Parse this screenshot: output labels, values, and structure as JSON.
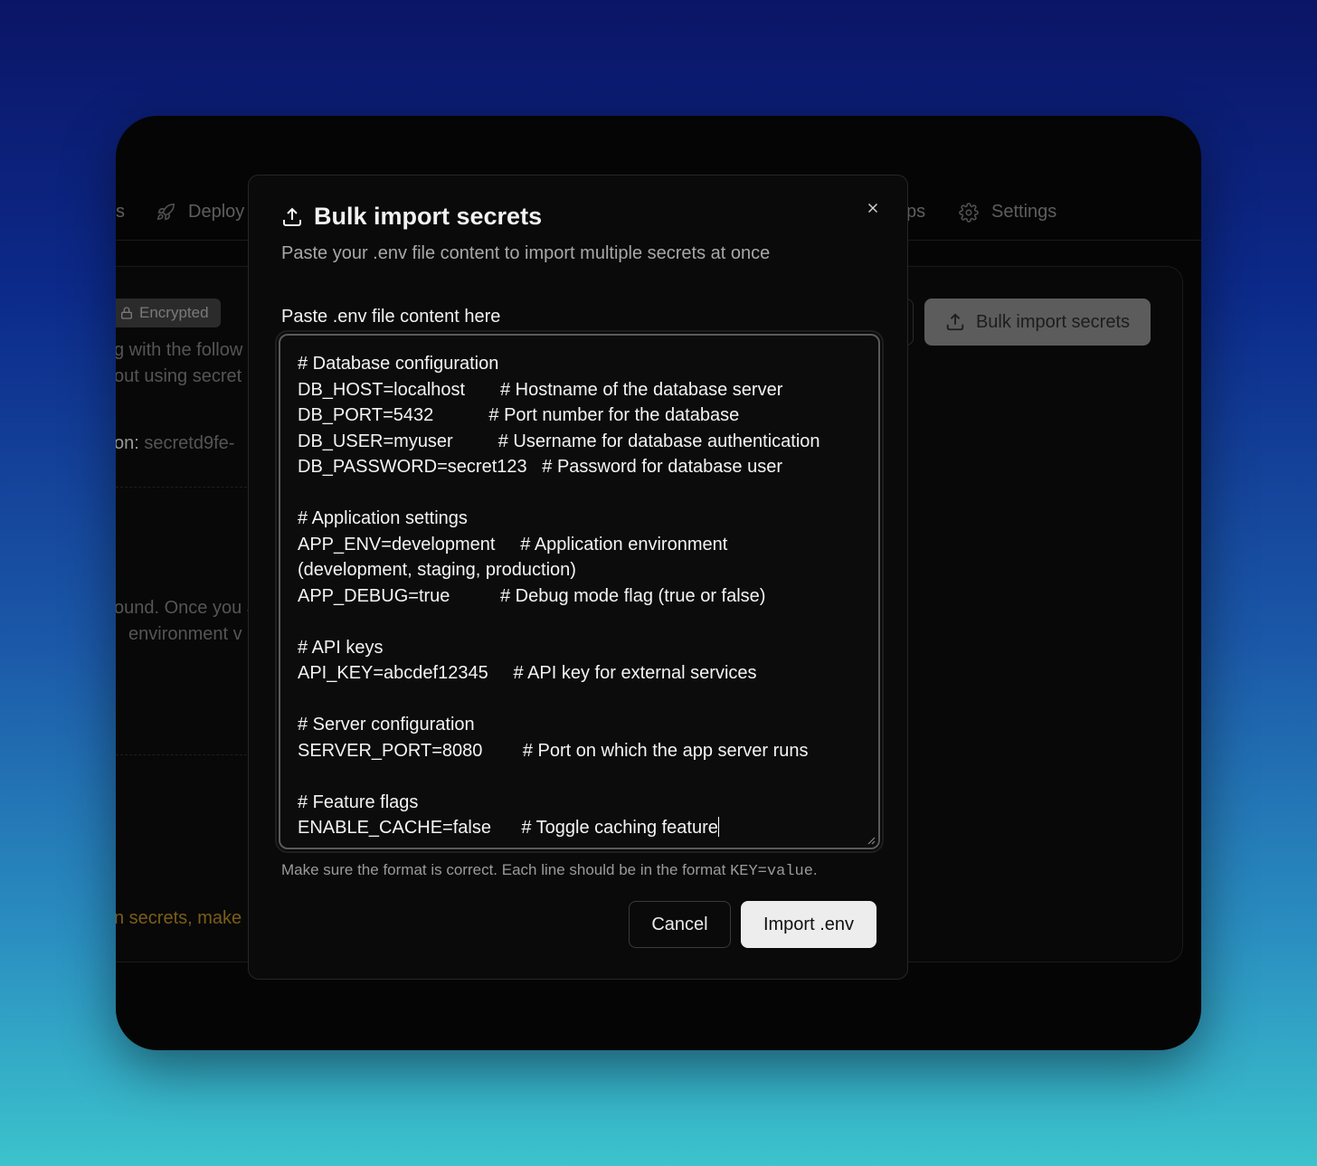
{
  "nav": {
    "items": [
      {
        "label": "s"
      },
      {
        "label": "Deploy"
      },
      {
        "label": "ps"
      },
      {
        "label": "Settings"
      }
    ]
  },
  "background": {
    "badge": "Encrypted",
    "line1": "g with the follow",
    "line2": "out using secret",
    "line3_label": "on:",
    "line3_value": "secretd9fe-",
    "empty1": "ound. Once you a",
    "empty2": "environment v",
    "warning": "n secrets, make",
    "bulk_button": "Bulk import secrets"
  },
  "modal": {
    "title": "Bulk import secrets",
    "subtitle": "Paste your .env file content to import multiple secrets at once",
    "field_label": "Paste .env file content here",
    "env_content": "# Database configuration\nDB_HOST=localhost       # Hostname of the database server\nDB_PORT=5432           # Port number for the database\nDB_USER=myuser         # Username for database authentication\nDB_PASSWORD=secret123   # Password for database user\n\n# Application settings\nAPP_ENV=development     # Application environment\n(development, staging, production)\nAPP_DEBUG=true          # Debug mode flag (true or false)\n\n# API keys\nAPI_KEY=abcdef12345     # API key for external services\n\n# Server configuration\nSERVER_PORT=8080        # Port on which the app server runs\n\n# Feature flags\nENABLE_CACHE=false      # Toggle caching feature",
    "help_prefix": "Make sure the format is correct. Each line should be in the format ",
    "help_code": "KEY=value",
    "help_suffix": ".",
    "cancel_label": "Cancel",
    "import_label": "Import .env"
  }
}
